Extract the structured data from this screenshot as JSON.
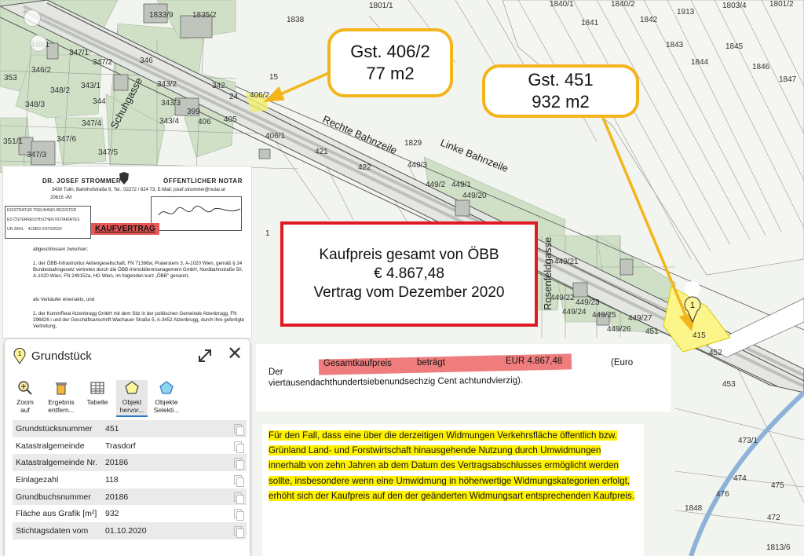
{
  "map": {
    "parcel_labels": [
      "1833/9",
      "1835/2",
      "1838",
      "1840/1",
      "1840/2",
      "1841",
      "1842",
      "1843",
      "1844",
      "1845",
      "1846",
      "1847",
      "348/1",
      "347/1",
      "347/2",
      "346",
      "343/2",
      "343/3",
      "399",
      "342",
      "353",
      "346/2",
      "348/3",
      "348/2",
      "343/1",
      "406",
      "406/1",
      "405",
      "15",
      "24",
      "406/2",
      "351/1",
      "347/3",
      "347/6",
      "347/4",
      "347/5",
      "343/4",
      "344",
      "421",
      "422",
      "1829",
      "449/3",
      "449/2",
      "449/1",
      "449/20",
      "449/21",
      "449/22",
      "449/23",
      "449/24",
      "449/25",
      "449/26",
      "449/27",
      "451",
      "415",
      "1",
      "452",
      "453",
      "473/1",
      "474",
      "475",
      "476",
      "472",
      "1813/6",
      "1848",
      "1913",
      "1803/4",
      "1801/2",
      "1801/1"
    ],
    "street_labels": [
      "Rechte Bahnzeile",
      "Linke Bahnzeile",
      "Rosenfeldgasse",
      "Schuhgasse"
    ],
    "marker_number": "1"
  },
  "callouts": {
    "gst_406": {
      "line1": "Gst. 406/2",
      "line2": "77 m2"
    },
    "gst_451": {
      "line1": "Gst. 451",
      "line2": "932 m2"
    }
  },
  "price_box": {
    "line1": "Kaufpreis gesamt von ÖBB",
    "line2": "€ 4.867,48",
    "line3": "Vertrag vom Dezember 2020"
  },
  "contract": {
    "notary_name": "DR. JOSEF STROMMER",
    "notary_title": "ÖFFENTLICHER NOTAR",
    "address": "3430 Tulln, Bahnhofstraße 9, Tel.: 02272 / 624 73, E-Mail: josef.strommer@notar.at",
    "gz": "20616 -/M",
    "stamp_left": "EGISTRATUR TREUHAND-REGISTER",
    "stamp_left2": "ES ÖSTERREICHISCHEN NOTARIATES",
    "stamp_left3": "UR ZAHL",
    "stamp_number": "411803-2/375/2020",
    "heading": "KAUFVERTRAG",
    "p0": "abgeschlossen zwischen:",
    "p1": "1. der ÖBB-Infrastruktur Aktiengesellschaft, FN 71396w, Praterstern 3, A-1020 Wien, gemäß § 24 Bundesbahngesetz vertreten durch die ÖBB-Immobilienmanagement GmbH, Nordbahnstraße 50, A-1020 Wien, FN 249152a, HG Wien, im folgenden kurz „ÖBB\" genannt,",
    "p2": "als Verkäufer einerseits, und",
    "p3": "2. der KommReal Atzenbrugg GmbH mit dem Sitz in der politischen Gemeinde Atzenbrugg, FN 296826 i und der Geschäftsanschrift Wachauer Straße 5, A-3452 Atzenbrugg, durch ihre gefertigte Vertretung,"
  },
  "quote": {
    "der": "Der",
    "gesamt": "Gesamtkaufpreis",
    "betraegt": "beträgt",
    "amount": "EUR 4.867,48",
    "euro": "(Euro",
    "words": "viertausendachthundertsiebenundsechzig Cent achtundvierzig)."
  },
  "clause": {
    "text": "Für den Fall, dass eine über die derzeitigen Widmungen Verkehrsfläche öffentlich bzw. Grünland Land- und Forstwirtschaft hinausgehende Nutzung durch Umwidmungen innerhalb von zehn Jahren ab dem Datum des Vertragsabschlusses ermöglicht werden sollte, insbesondere wenn eine Umwidmung in höherwertige Widmungskategorien erfolgt, erhöht sich der Kaufpreis auf den der geänderten Widmungsart entsprechenden Kaufpreis."
  },
  "panel": {
    "title": "Grundstück",
    "pin_number": "1",
    "tools": [
      {
        "label1": "Zoom",
        "label2": "auf"
      },
      {
        "label1": "Ergebnis",
        "label2": "entfern..."
      },
      {
        "label1": "Tabelle",
        "label2": ""
      },
      {
        "label1": "Objekt",
        "label2": "hervor..."
      },
      {
        "label1": "Objekte",
        "label2": "Selekti..."
      }
    ],
    "rows": [
      {
        "key": "Grundstücksnummer",
        "value": "451"
      },
      {
        "key": "Katastralgemeinde",
        "value": "Trasdorf"
      },
      {
        "key": "Katastralgemeinde Nr.",
        "value": "20186"
      },
      {
        "key": "Einlagezahl",
        "value": "118"
      },
      {
        "key": "Grundbuchsnummer",
        "value": "20186"
      },
      {
        "key": "Fläche aus Grafik [m²]",
        "value": "932"
      },
      {
        "key": "Stichtagsdaten vom",
        "value": "01.10.2020"
      }
    ]
  },
  "colors": {
    "callout_border": "#f3b51b",
    "price_border": "#e01a22",
    "highlight_yellow": "#fff200",
    "highlight_red": "#ef7d7d",
    "parcel_highlight": "#fbf58a"
  }
}
